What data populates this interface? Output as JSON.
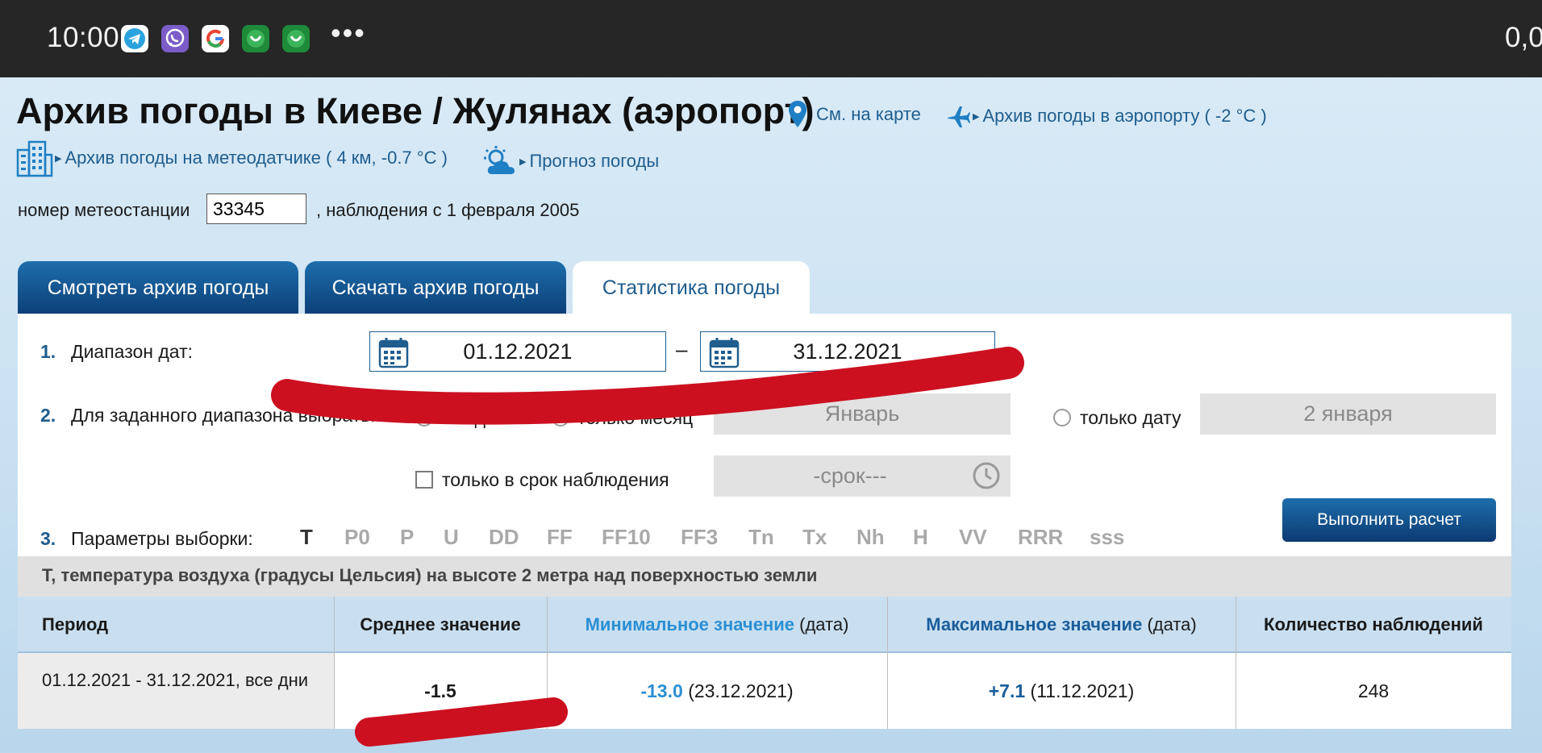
{
  "statusbar": {
    "time": "10:00",
    "apps": [
      "telegram-icon",
      "viber-icon",
      "google-icon",
      "whatsapp-icon",
      "whatsapp-icon"
    ],
    "more": "•••",
    "right_text": "0,0"
  },
  "header": {
    "title": "Архив погоды в Киеве / Жулянах (аэропорт)",
    "map_link": "См. на карте",
    "airport_link": "Архив погоды в аэропорту ( -2 °C )",
    "sensor_link": "Архив погоды на метеодатчике ( 4 км, -0.7 °C )",
    "forecast_link": "Прогноз погоды",
    "station_label": "номер метеостанции",
    "station_value": "33345",
    "station_suffix": ", наблюдения с 1 февраля 2005"
  },
  "tabs": [
    {
      "label": "Смотреть архив погоды",
      "active": false
    },
    {
      "label": "Скачать архив погоды",
      "active": false
    },
    {
      "label": "Статистика погоды",
      "active": true
    }
  ],
  "form": {
    "step1": {
      "num": "1.",
      "label": "Диапазон дат:",
      "date_from": "01.12.2021",
      "separator": "–",
      "date_to": "31.12.2021"
    },
    "step2": {
      "num": "2.",
      "label": "Для заданного диапазона выбрать:",
      "opt_all_days": "все дни",
      "opt_only_month": "только месяц",
      "month_value": "Январь",
      "opt_only_date": "только дату",
      "date_value": "2 января",
      "opt_only_term": "только в срок наблюдения",
      "term_value": "-срок---"
    },
    "step3": {
      "num": "3.",
      "label": "Параметры выборки:",
      "params": [
        "T",
        "P0",
        "P",
        "U",
        "DD",
        "FF",
        "FF10",
        "FF3",
        "Tn",
        "Tx",
        "Nh",
        "H",
        "VV",
        "RRR",
        "sss"
      ],
      "selected": "T"
    },
    "calc_button": "Выполнить расчет"
  },
  "result": {
    "description": "Т, температура воздуха (градусы Цельсия) на высоте 2 метра над поверхностью земли",
    "headers": {
      "period": "Период",
      "mean": "Среднее значение",
      "min": "Минимальное значение",
      "min_suffix": "(дата)",
      "max": "Максимальное значение",
      "max_suffix": "(дата)",
      "count": "Количество наблюдений"
    },
    "row": {
      "period": "01.12.2021 - 31.12.2021, все дни",
      "mean": "-1.5",
      "min_value": "-13.0",
      "min_date": "(23.12.2021)",
      "max_value": "+7.1",
      "max_date": "(11.12.2021)",
      "count": "248"
    }
  },
  "colors": {
    "accent": "#1f5d8e",
    "tab_dark": "#0d3f78",
    "highlight_light": "#2b8fd3",
    "scribble": "#cc1020"
  }
}
